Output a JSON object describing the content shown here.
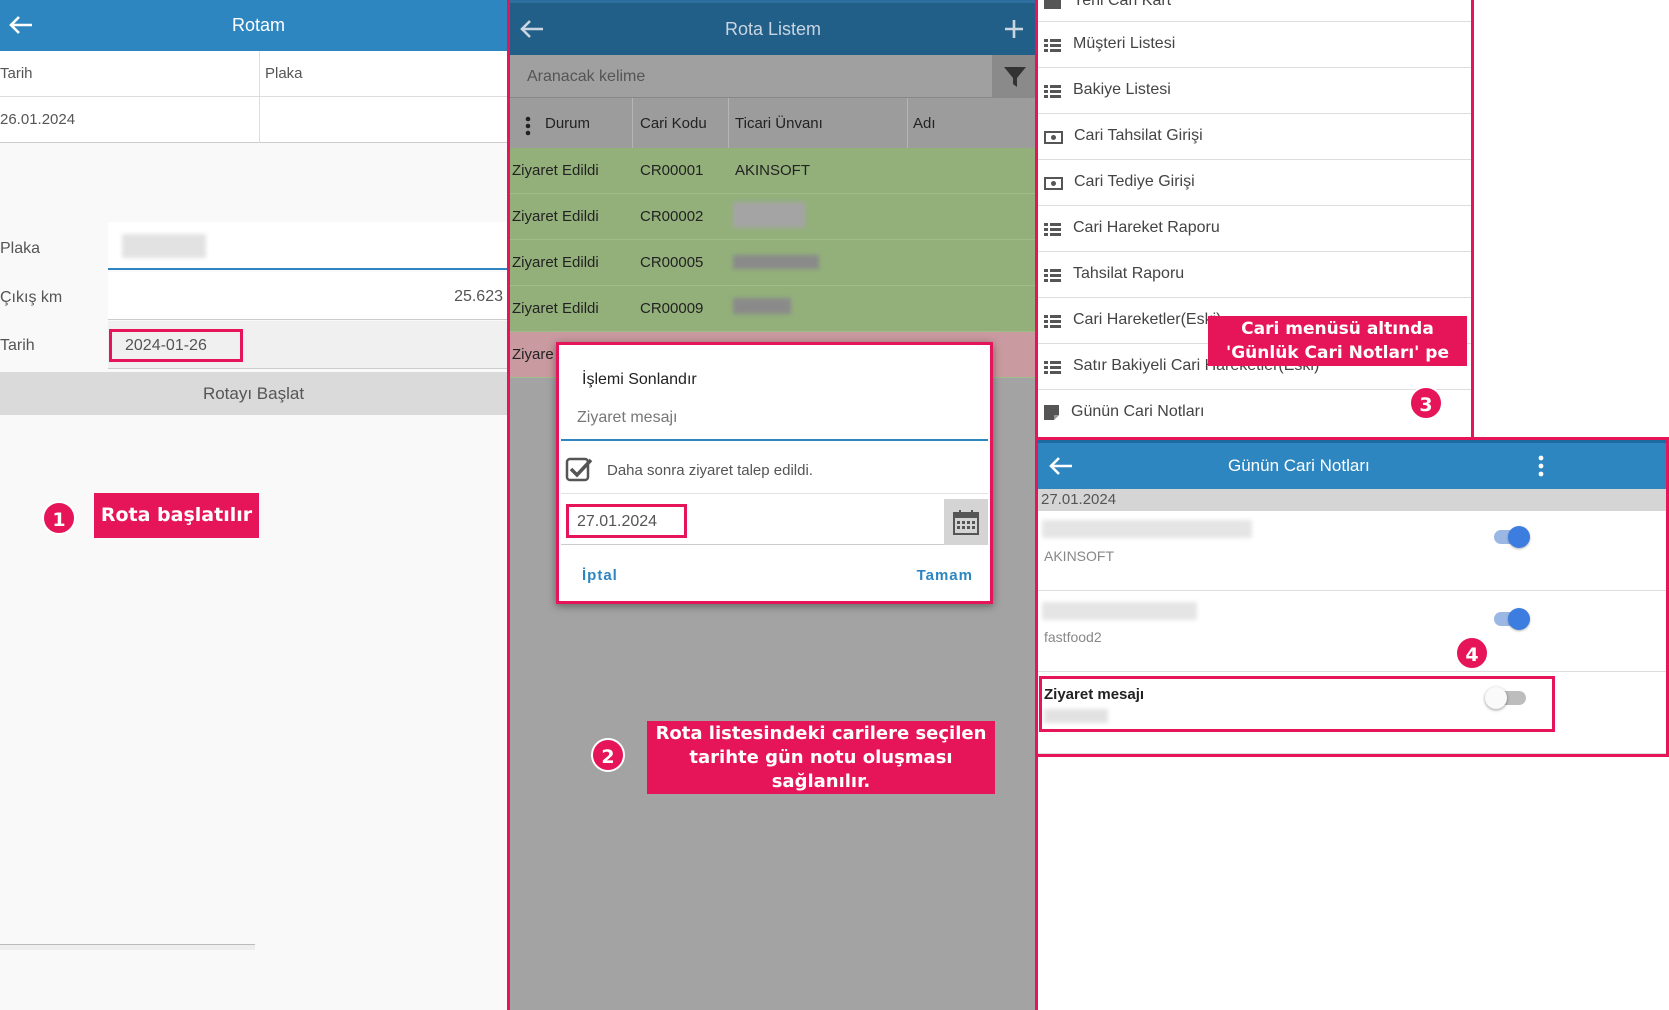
{
  "panel1": {
    "title": "Rotam",
    "table_headers": [
      "Tarih",
      "Plaka"
    ],
    "table_row": [
      "26.01.2024",
      ""
    ],
    "form": {
      "plaka_label": "Plaka",
      "cikis_label": "Çıkış km",
      "cikis_value": "25.623",
      "tarih_label": "Tarih",
      "tarih_value": "2024-01-26"
    },
    "start_button": "Rotayı Başlat",
    "annotation_number": "1",
    "annotation_text": "Rota başlatılır"
  },
  "panel2": {
    "title": "Rota Listem",
    "search_placeholder": "Aranacak kelime",
    "columns": [
      "Durum",
      "Cari Kodu",
      "Ticari Ünvanı",
      "Adı"
    ],
    "rows": [
      {
        "durum": "Ziyaret Edildi",
        "kod": "CR00001",
        "unvan": "AKINSOFT"
      },
      {
        "durum": "Ziyaret Edildi",
        "kod": "CR00002",
        "unvan": ""
      },
      {
        "durum": "Ziyaret Edildi",
        "kod": "CR00005",
        "unvan": ""
      },
      {
        "durum": "Ziyaret Edildi",
        "kod": "CR00009",
        "unvan": ""
      },
      {
        "durum": "Ziyare",
        "kod": "",
        "unvan": ""
      }
    ],
    "dialog": {
      "title": "İşlemi Sonlandır",
      "message_placeholder": "Ziyaret mesajı",
      "checkbox_label": "Daha sonra ziyaret talep edildi.",
      "date_value": "27.01.2024",
      "cancel": "İptal",
      "ok": "Tamam"
    },
    "annotation_number": "2",
    "annotation_text_line1": "Rota listesindeki carilere seçilen",
    "annotation_text_line2": "tarihte gün notu oluşması",
    "annotation_text_line3": "sağlanılır."
  },
  "panel3": {
    "top_item": "Yeni Cari Kart",
    "items": [
      "Müşteri Listesi",
      "Bakiye Listesi",
      "Cari Tahsilat Girişi",
      "Cari Tediye Girişi",
      "Cari Hareket Raporu",
      "Tahsilat Raporu",
      "Cari Hareketler(Eski)",
      "Satır Bakiyeli Cari Hareketler(Eski)",
      "Günün Cari Notları"
    ],
    "annotation_line1": "Cari menüsü altında",
    "annotation_line2": "'Günlük  Cari  Notları' pe",
    "annotation_number": "3"
  },
  "panel4": {
    "title": "Günün Cari Notları",
    "date_header": "27.01.2024",
    "notes": [
      {
        "subtitle": "AKINSOFT",
        "enabled": true
      },
      {
        "subtitle": "fastfood2",
        "enabled": true
      },
      {
        "title": "Ziyaret mesajı",
        "enabled": false
      }
    ],
    "annotation_number": "4"
  }
}
